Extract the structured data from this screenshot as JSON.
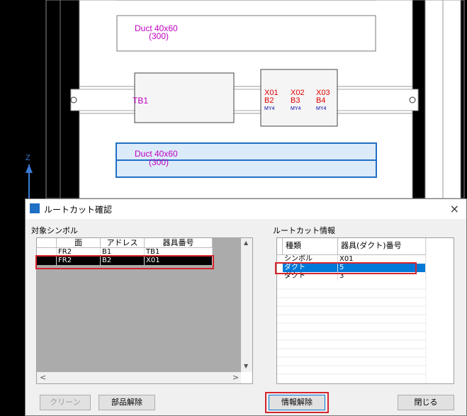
{
  "cad": {
    "duct_top_label": "Duct 40x60",
    "duct_top_sub": "(300)",
    "duct_bottom_label": "Duct 40x60",
    "duct_bottom_sub": "(300)",
    "tb_label": "TB1",
    "relays": [
      {
        "a": "X01",
        "b": "B2",
        "c": "MY4"
      },
      {
        "a": "X02",
        "b": "B3",
        "c": "MY4"
      },
      {
        "a": "X03",
        "b": "B4",
        "c": "MY4"
      }
    ],
    "axis_label": "Z"
  },
  "dialog": {
    "title": "ルートカット確認",
    "close": "×",
    "left_group_label": "対象シンボル",
    "right_group_label": "ルートカット情報",
    "left_table": {
      "headers": [
        "面",
        "アドレス",
        "器具番号"
      ],
      "rows": [
        [
          "FR2",
          "B1",
          "TB1"
        ],
        [
          "FR2",
          "B2",
          "X01"
        ]
      ]
    },
    "right_table": {
      "headers": [
        "種類",
        "器具(ダクト)番号"
      ],
      "rows": [
        [
          "シンボル",
          "X01"
        ],
        [
          "ダクト",
          "5"
        ],
        [
          "ダクト",
          "3"
        ]
      ]
    },
    "buttons": {
      "clean": "クリーン",
      "part_release": "部品解除",
      "info_release": "情報解除",
      "close": "閉じる"
    },
    "scroll": {
      "up": "▲",
      "down": "▼",
      "left": "<",
      "right": ">"
    }
  },
  "colors": {
    "cad_magenta": "#c000c0",
    "cad_red": "#e00000",
    "selection_blue": "#0078d7",
    "highlight_red": "#d6242c"
  }
}
